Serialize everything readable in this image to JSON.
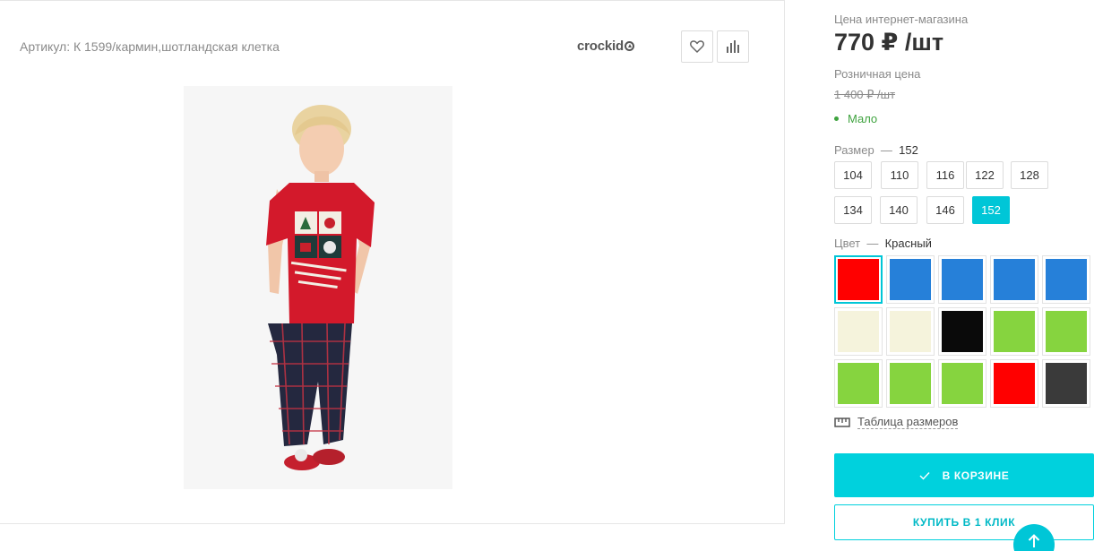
{
  "product": {
    "sku_text": "Артикул: К 1599/кармин,шотландская клетка",
    "brand": "crockid",
    "photo_alt": "Фото товара"
  },
  "actions": {
    "favorite_icon": "heart-icon",
    "compare_icon": "bar-chart-icon"
  },
  "pricing": {
    "online_label": "Цена интернет-магазина",
    "online_price": "770 ₽ /шт",
    "retail_label": "Розничная цена",
    "retail_price": "1 400 ₽ /шт",
    "stock": "Мало",
    "stock_color": "#3fa33f"
  },
  "size": {
    "label": "Размер",
    "separator": "—",
    "selected": "152",
    "options": [
      "104",
      "110",
      "116",
      "122",
      "128",
      "134",
      "140",
      "146",
      "152"
    ]
  },
  "color": {
    "label": "Цвет",
    "separator": "—",
    "selected": "Красный",
    "swatches": [
      "#ff0000",
      "#2680d9",
      "#2680d9",
      "#2680d9",
      "#2680d9",
      "#f5f3dc",
      "#f5f3dc",
      "#0a0a0a",
      "#86d43f",
      "#86d43f",
      "#86d43f",
      "#86d43f",
      "#86d43f",
      "#ff0000",
      "#3a3a3a"
    ],
    "selected_index": 0
  },
  "size_table": {
    "label": "Таблица размеров",
    "icon": "ruler-icon"
  },
  "buttons": {
    "cart_label": "В КОРЗИНЕ",
    "cart_icon": "check-icon",
    "one_click_label": "КУПИТЬ В 1 КЛИК",
    "scroll_top_icon": "arrow-up-icon"
  },
  "colors": {
    "accent": "#00c6d7"
  }
}
